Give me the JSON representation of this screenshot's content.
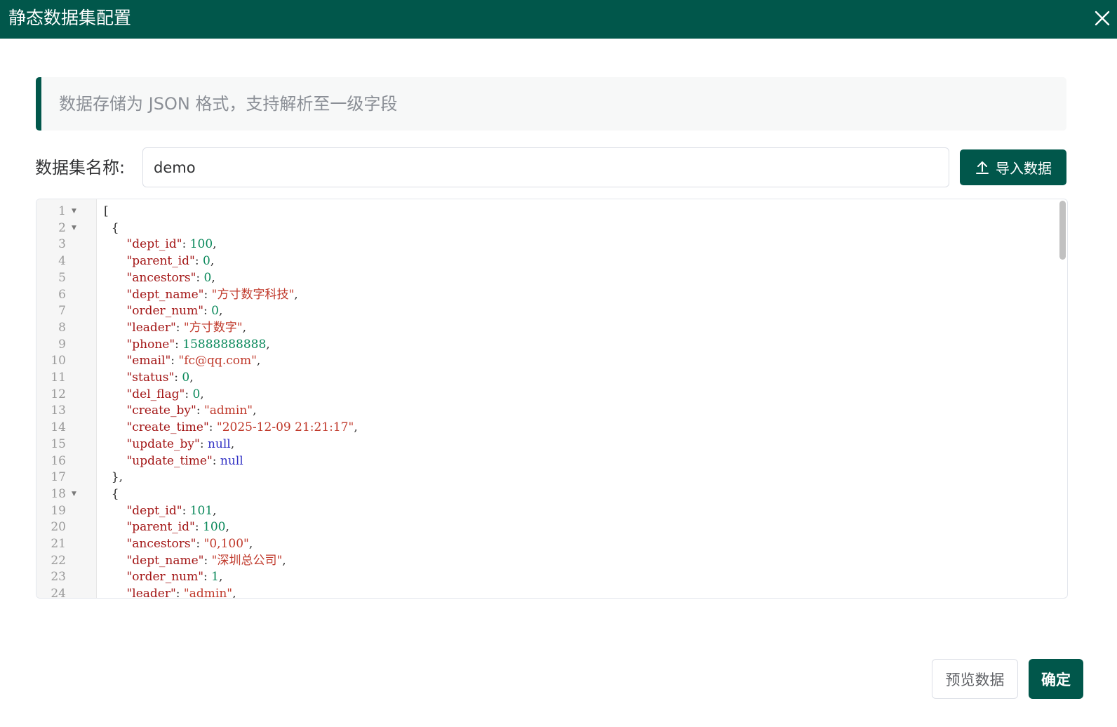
{
  "dialog": {
    "title": "静态数据集配置",
    "tip": "数据存储为 JSON 格式，支持解析至一级字段",
    "name_label": "数据集名称:",
    "name_value": "demo",
    "import_label": "导入数据",
    "preview_label": "预览数据",
    "confirm_label": "确定"
  },
  "colors": {
    "primary": "#01574b",
    "tip_bg": "#f7f8f8"
  },
  "editor": {
    "folded_lines": [
      1,
      2,
      18
    ],
    "lines": [
      [
        {
          "t": "punc",
          "v": "["
        }
      ],
      [
        {
          "t": "punc",
          "v": "  {"
        }
      ],
      [
        {
          "t": "punc",
          "v": "      "
        },
        {
          "t": "key",
          "v": "\"dept_id\""
        },
        {
          "t": "punc",
          "v": ": "
        },
        {
          "t": "num",
          "v": "100"
        },
        {
          "t": "punc",
          "v": ","
        }
      ],
      [
        {
          "t": "punc",
          "v": "      "
        },
        {
          "t": "key",
          "v": "\"parent_id\""
        },
        {
          "t": "punc",
          "v": ": "
        },
        {
          "t": "num",
          "v": "0"
        },
        {
          "t": "punc",
          "v": ","
        }
      ],
      [
        {
          "t": "punc",
          "v": "      "
        },
        {
          "t": "key",
          "v": "\"ancestors\""
        },
        {
          "t": "punc",
          "v": ": "
        },
        {
          "t": "num",
          "v": "0"
        },
        {
          "t": "punc",
          "v": ","
        }
      ],
      [
        {
          "t": "punc",
          "v": "      "
        },
        {
          "t": "key",
          "v": "\"dept_name\""
        },
        {
          "t": "punc",
          "v": ": "
        },
        {
          "t": "str",
          "v": "\"方寸数字科技\""
        },
        {
          "t": "punc",
          "v": ","
        }
      ],
      [
        {
          "t": "punc",
          "v": "      "
        },
        {
          "t": "key",
          "v": "\"order_num\""
        },
        {
          "t": "punc",
          "v": ": "
        },
        {
          "t": "num",
          "v": "0"
        },
        {
          "t": "punc",
          "v": ","
        }
      ],
      [
        {
          "t": "punc",
          "v": "      "
        },
        {
          "t": "key",
          "v": "\"leader\""
        },
        {
          "t": "punc",
          "v": ": "
        },
        {
          "t": "str",
          "v": "\"方寸数字\""
        },
        {
          "t": "punc",
          "v": ","
        }
      ],
      [
        {
          "t": "punc",
          "v": "      "
        },
        {
          "t": "key",
          "v": "\"phone\""
        },
        {
          "t": "punc",
          "v": ": "
        },
        {
          "t": "num",
          "v": "15888888888"
        },
        {
          "t": "punc",
          "v": ","
        }
      ],
      [
        {
          "t": "punc",
          "v": "      "
        },
        {
          "t": "key",
          "v": "\"email\""
        },
        {
          "t": "punc",
          "v": ": "
        },
        {
          "t": "str",
          "v": "\"fc@qq.com\""
        },
        {
          "t": "punc",
          "v": ","
        }
      ],
      [
        {
          "t": "punc",
          "v": "      "
        },
        {
          "t": "key",
          "v": "\"status\""
        },
        {
          "t": "punc",
          "v": ": "
        },
        {
          "t": "num",
          "v": "0"
        },
        {
          "t": "punc",
          "v": ","
        }
      ],
      [
        {
          "t": "punc",
          "v": "      "
        },
        {
          "t": "key",
          "v": "\"del_flag\""
        },
        {
          "t": "punc",
          "v": ": "
        },
        {
          "t": "num",
          "v": "0"
        },
        {
          "t": "punc",
          "v": ","
        }
      ],
      [
        {
          "t": "punc",
          "v": "      "
        },
        {
          "t": "key",
          "v": "\"create_by\""
        },
        {
          "t": "punc",
          "v": ": "
        },
        {
          "t": "str",
          "v": "\"admin\""
        },
        {
          "t": "punc",
          "v": ","
        }
      ],
      [
        {
          "t": "punc",
          "v": "      "
        },
        {
          "t": "key",
          "v": "\"create_time\""
        },
        {
          "t": "punc",
          "v": ": "
        },
        {
          "t": "str",
          "v": "\"2025-12-09 21:21:17\""
        },
        {
          "t": "punc",
          "v": ","
        }
      ],
      [
        {
          "t": "punc",
          "v": "      "
        },
        {
          "t": "key",
          "v": "\"update_by\""
        },
        {
          "t": "punc",
          "v": ": "
        },
        {
          "t": "kw",
          "v": "null"
        },
        {
          "t": "punc",
          "v": ","
        }
      ],
      [
        {
          "t": "punc",
          "v": "      "
        },
        {
          "t": "key",
          "v": "\"update_time\""
        },
        {
          "t": "punc",
          "v": ": "
        },
        {
          "t": "kw",
          "v": "null"
        }
      ],
      [
        {
          "t": "punc",
          "v": "  },"
        }
      ],
      [
        {
          "t": "punc",
          "v": "  {"
        }
      ],
      [
        {
          "t": "punc",
          "v": "      "
        },
        {
          "t": "key",
          "v": "\"dept_id\""
        },
        {
          "t": "punc",
          "v": ": "
        },
        {
          "t": "num",
          "v": "101"
        },
        {
          "t": "punc",
          "v": ","
        }
      ],
      [
        {
          "t": "punc",
          "v": "      "
        },
        {
          "t": "key",
          "v": "\"parent_id\""
        },
        {
          "t": "punc",
          "v": ": "
        },
        {
          "t": "num",
          "v": "100"
        },
        {
          "t": "punc",
          "v": ","
        }
      ],
      [
        {
          "t": "punc",
          "v": "      "
        },
        {
          "t": "key",
          "v": "\"ancestors\""
        },
        {
          "t": "punc",
          "v": ": "
        },
        {
          "t": "str",
          "v": "\"0,100\""
        },
        {
          "t": "punc",
          "v": ","
        }
      ],
      [
        {
          "t": "punc",
          "v": "      "
        },
        {
          "t": "key",
          "v": "\"dept_name\""
        },
        {
          "t": "punc",
          "v": ": "
        },
        {
          "t": "str",
          "v": "\"深圳总公司\""
        },
        {
          "t": "punc",
          "v": ","
        }
      ],
      [
        {
          "t": "punc",
          "v": "      "
        },
        {
          "t": "key",
          "v": "\"order_num\""
        },
        {
          "t": "punc",
          "v": ": "
        },
        {
          "t": "num",
          "v": "1"
        },
        {
          "t": "punc",
          "v": ","
        }
      ],
      [
        {
          "t": "punc",
          "v": "      "
        },
        {
          "t": "key",
          "v": "\"leader\""
        },
        {
          "t": "punc",
          "v": ": "
        },
        {
          "t": "str",
          "v": "\"admin\""
        },
        {
          "t": "punc",
          "v": ","
        }
      ]
    ]
  }
}
